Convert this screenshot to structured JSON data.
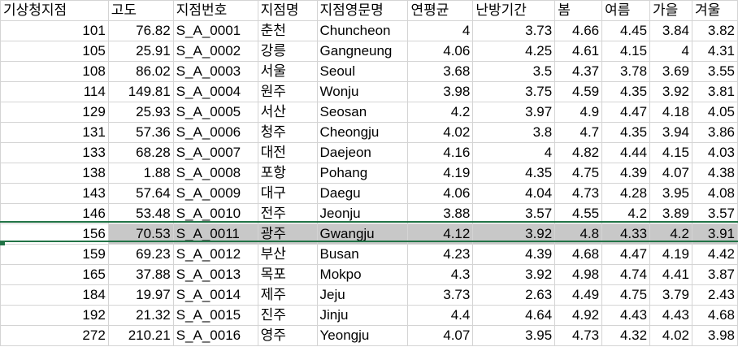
{
  "header": [
    "기상청지점",
    "고도",
    "지점번호",
    "지점명",
    "지점영문명",
    "연평균",
    "난방기간",
    "봄",
    "여름",
    "가을",
    "겨울"
  ],
  "rows": [
    [
      "101",
      "76.82",
      "S_A_0001",
      "춘천",
      "Chuncheon",
      "4",
      "3.73",
      "4.66",
      "4.45",
      "3.84",
      "3.82"
    ],
    [
      "105",
      "25.91",
      "S_A_0002",
      "강릉",
      "Gangneung",
      "4.06",
      "4.25",
      "4.61",
      "4.15",
      "4",
      "4.31"
    ],
    [
      "108",
      "86.02",
      "S_A_0003",
      "서울",
      "Seoul",
      "3.68",
      "3.5",
      "4.37",
      "3.78",
      "3.69",
      "3.55"
    ],
    [
      "114",
      "149.81",
      "S_A_0004",
      "원주",
      "Wonju",
      "3.98",
      "3.75",
      "4.59",
      "4.35",
      "3.92",
      "3.81"
    ],
    [
      "129",
      "25.93",
      "S_A_0005",
      "서산",
      "Seosan",
      "4.2",
      "3.97",
      "4.9",
      "4.47",
      "4.18",
      "4.05"
    ],
    [
      "131",
      "57.36",
      "S_A_0006",
      "청주",
      "Cheongju",
      "4.02",
      "3.8",
      "4.7",
      "4.35",
      "3.94",
      "3.86"
    ],
    [
      "133",
      "68.28",
      "S_A_0007",
      "대전",
      "Daejeon",
      "4.16",
      "4",
      "4.82",
      "4.44",
      "4.15",
      "4.03"
    ],
    [
      "138",
      "1.88",
      "S_A_0008",
      "포항",
      "Pohang",
      "4.19",
      "4.35",
      "4.75",
      "4.39",
      "4.07",
      "4.38"
    ],
    [
      "143",
      "57.64",
      "S_A_0009",
      "대구",
      "Daegu",
      "4.06",
      "4.04",
      "4.73",
      "4.28",
      "3.95",
      "4.08"
    ],
    [
      "146",
      "53.48",
      "S_A_0010",
      "전주",
      "Jeonju",
      "3.88",
      "3.57",
      "4.55",
      "4.2",
      "3.89",
      "3.57"
    ],
    [
      "156",
      "70.53",
      "S_A_0011",
      "광주",
      "Gwangju",
      "4.12",
      "3.92",
      "4.8",
      "4.33",
      "4.2",
      "3.91"
    ],
    [
      "159",
      "69.23",
      "S_A_0012",
      "부산",
      "Busan",
      "4.23",
      "4.39",
      "4.68",
      "4.47",
      "4.19",
      "4.42"
    ],
    [
      "165",
      "37.88",
      "S_A_0013",
      "목포",
      "Mokpo",
      "4.3",
      "3.92",
      "4.98",
      "4.74",
      "4.41",
      "3.87"
    ],
    [
      "184",
      "19.97",
      "S_A_0014",
      "제주",
      "Jeju",
      "3.73",
      "2.63",
      "4.49",
      "4.75",
      "3.79",
      "2.43"
    ],
    [
      "192",
      "21.32",
      "S_A_0015",
      "진주",
      "Jinju",
      "4.4",
      "4.64",
      "4.92",
      "4.43",
      "4.43",
      "4.68"
    ],
    [
      "272",
      "210.21",
      "S_A_0016",
      "영주",
      "Yeongju",
      "4.07",
      "3.95",
      "4.73",
      "4.32",
      "4.02",
      "3.98"
    ]
  ],
  "selected_row_index": 10,
  "colors": {
    "selection_border": "#217346",
    "selection_fill": "#c8c8c8",
    "gridline": "#d4d4d4"
  }
}
